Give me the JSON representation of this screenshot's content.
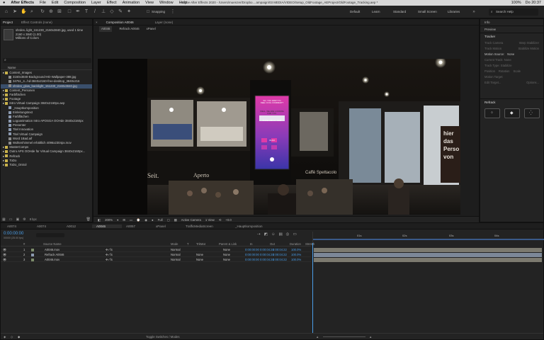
{
  "menubar": {
    "app": "After Effects",
    "items": [
      "File",
      "Edit",
      "Composition",
      "Layer",
      "Effect",
      "Animation",
      "View",
      "Window",
      "Help"
    ],
    "title": "Adobe After Effects 2020 - /Users/muenzer/Dropbo....ampaign/03 MEDIA/VIDEO/Setup_OldFootage_AEProject/OldFootage_Tracking.aep *",
    "right": [
      "100%",
      "Do 20:37"
    ]
  },
  "toolbar": {
    "snapping": "Snapping",
    "workspaces": [
      "Default",
      "Learn",
      "Standard",
      "Small Screen",
      "Libraries"
    ],
    "search_placeholder": "Search Help"
  },
  "project_panel": {
    "tabs": [
      "Project",
      "Effect Controls (none)"
    ],
    "preview_name": "shrdes..light_151230_2160x3840.jpg",
    "preview_meta1": ", used 1 time",
    "preview_meta2": "2160 x 3840 (1.00)",
    "preview_meta3": "Millions of Colors",
    "column_name": "Name",
    "items": [
      {
        "label": "Content_Images",
        "type": "folder",
        "color": "#c9b24b",
        "indent": 0
      },
      {
        "label": "3160x3840-Background-HD-Wallpaper-388.jpg",
        "type": "file",
        "color": "#8a8a8a",
        "indent": 1
      },
      {
        "label": "34751_4...hd-3840x2160-free-desktop_3840x216",
        "type": "file",
        "color": "#8a8a8a",
        "indent": 1
      },
      {
        "label": "shrdes_glow_backlight_151230_2160x3840.jpg",
        "type": "file",
        "color": "#8a8a8a",
        "indent": 1,
        "selected": true
      },
      {
        "label": "Content_Personen",
        "type": "folder",
        "color": "#c9b24b",
        "indent": 0
      },
      {
        "label": "Farbflächen",
        "type": "folder",
        "color": "#c9b24b",
        "indent": 0
      },
      {
        "label": "Footage",
        "type": "folder",
        "color": "#c9b24b",
        "indent": 0
      },
      {
        "label": "Intro Virtual Campaign 3840x2160px.aep",
        "type": "folder",
        "color": "#c9b24b",
        "indent": 0
      },
      {
        "label": "_Hauptkomposition",
        "type": "comp",
        "color": "#8c9ab0",
        "indent": 1
      },
      {
        "label": "Einleitungstext",
        "type": "comp",
        "color": "#8c9ab0",
        "indent": 1
      },
      {
        "label": "Farbflächen",
        "type": "comp",
        "color": "#8c9ab0",
        "indent": 1
      },
      {
        "label": "Logoanimation Intro APOSGA OOHde 3840x2160px",
        "type": "comp",
        "color": "#8c9ab0",
        "indent": 1
      },
      {
        "label": "Presenter",
        "type": "comp",
        "color": "#8c9ab0",
        "indent": 1
      },
      {
        "label": "Titel Innovation",
        "type": "comp",
        "color": "#8c9ab0",
        "indent": 1
      },
      {
        "label": "Titel Virtual Campaign",
        "type": "comp",
        "color": "#8c9ab0",
        "indent": 1
      },
      {
        "label": "Word 1Bad.aif",
        "type": "file",
        "color": "#8a8a8a",
        "indent": 1
      },
      {
        "label": "Wolkenhimmel erhältlich 4096x2304px.mov",
        "type": "file",
        "color": "#8a8a8a",
        "indent": 1
      },
      {
        "label": "MasterComps",
        "type": "folder",
        "color": "#c9b24b",
        "indent": 0
      },
      {
        "label": "Outro APS OOHde für Virtual Campaign 3840x2160px...",
        "type": "folder",
        "color": "#c9b24b",
        "indent": 0
      },
      {
        "label": "Refrack",
        "type": "folder",
        "color": "#c9b24b",
        "indent": 0
      },
      {
        "label": "ToDo",
        "type": "folder",
        "color": "#c9b24b",
        "indent": 0
      },
      {
        "label": "ToDo_Ontrol",
        "type": "folder",
        "color": "#c9b24b",
        "indent": 0
      }
    ],
    "bpc": "8 bpc"
  },
  "viewer": {
    "tabs": [
      "Composition A0046",
      "Layer (none)"
    ],
    "subtabs": [
      "A0046",
      "Refrack A0046",
      "xPanel"
    ],
    "zoom": "200%",
    "resolution": "Full",
    "camera": "Active Camera",
    "views": "1 View",
    "exposure": "+0.0",
    "scene_text": {
      "shop_left": "Seit.",
      "shop_mid": "Aperto",
      "shop_right": "Caffè Spettacolo",
      "billboard_line1": "SO, YOU WANT TO",
      "billboard_line2": "FEEL COOL COMMENT?",
      "billboard_line3": "WELL, WE ARE LOOKING",
      "billboard_line4": "FOR YOU.",
      "billboard_line5": "KNOW ABOUT THAT",
      "billboard_logo": "OLKO",
      "sign_right1": "hier",
      "sign_right2": "das",
      "sign_right3": "Perso",
      "sign_right4": "von"
    }
  },
  "right_panel": {
    "items": [
      "Info",
      "Preview"
    ],
    "tracker": {
      "title": "Tracker",
      "row1": [
        "Track Camera",
        "Warp Stabilizer"
      ],
      "row2": [
        "Track Motion",
        "Stabilize Motion"
      ],
      "motion_source_label": "Motion Source:",
      "motion_source_value": "None",
      "current_track": "Current Track:  None",
      "track_type": "Track Type:  Stabilize",
      "checks": [
        "Position",
        "Rotation",
        "Scale"
      ],
      "motion_target": "Motion Target:",
      "edit_target": "Edit Target...",
      "options": "Options..."
    },
    "refrack": "Refrack"
  },
  "timeline": {
    "tabs": [
      "A0074",
      "A0074",
      "A0012",
      "A0046",
      "A0057",
      "xPanel",
      "TrafficMediaScreen",
      "_Hauptkomposition"
    ],
    "active_tab": 3,
    "timecode": "0:00:00:00",
    "timecode_sub": "00000 (25.00 fps)",
    "columns": [
      "#",
      "Source Name",
      "Mode",
      "T",
      "TrkMat",
      "Parent & Link",
      "In",
      "Out",
      "Duration",
      "Stretch"
    ],
    "layers": [
      {
        "num": "1",
        "name": "A0046.mov",
        "mode": "Normal",
        "trkmat": "",
        "parent": "None",
        "in": "0:00:00:00",
        "out": "0:00:04:21",
        "dur": "0:00:04:22",
        "stretch": "100.0%"
      },
      {
        "num": "2",
        "name": "Refrack A0046",
        "mode": "Normal",
        "trkmat": "None",
        "parent": "None",
        "in": "0:00:00:00",
        "out": "0:00:04:21",
        "dur": "0:00:04:22",
        "stretch": "100.0%"
      },
      {
        "num": "3",
        "name": "A0046.mov",
        "mode": "Normal",
        "trkmat": "None",
        "parent": "None",
        "in": "0:00:00:00",
        "out": "0:00:04:21",
        "dur": "0:00:04:22",
        "stretch": "100.0%"
      }
    ],
    "ruler": [
      "01s",
      "02s",
      "03s",
      "04s"
    ],
    "toggle_label": "Toggle Switches / Modes"
  }
}
